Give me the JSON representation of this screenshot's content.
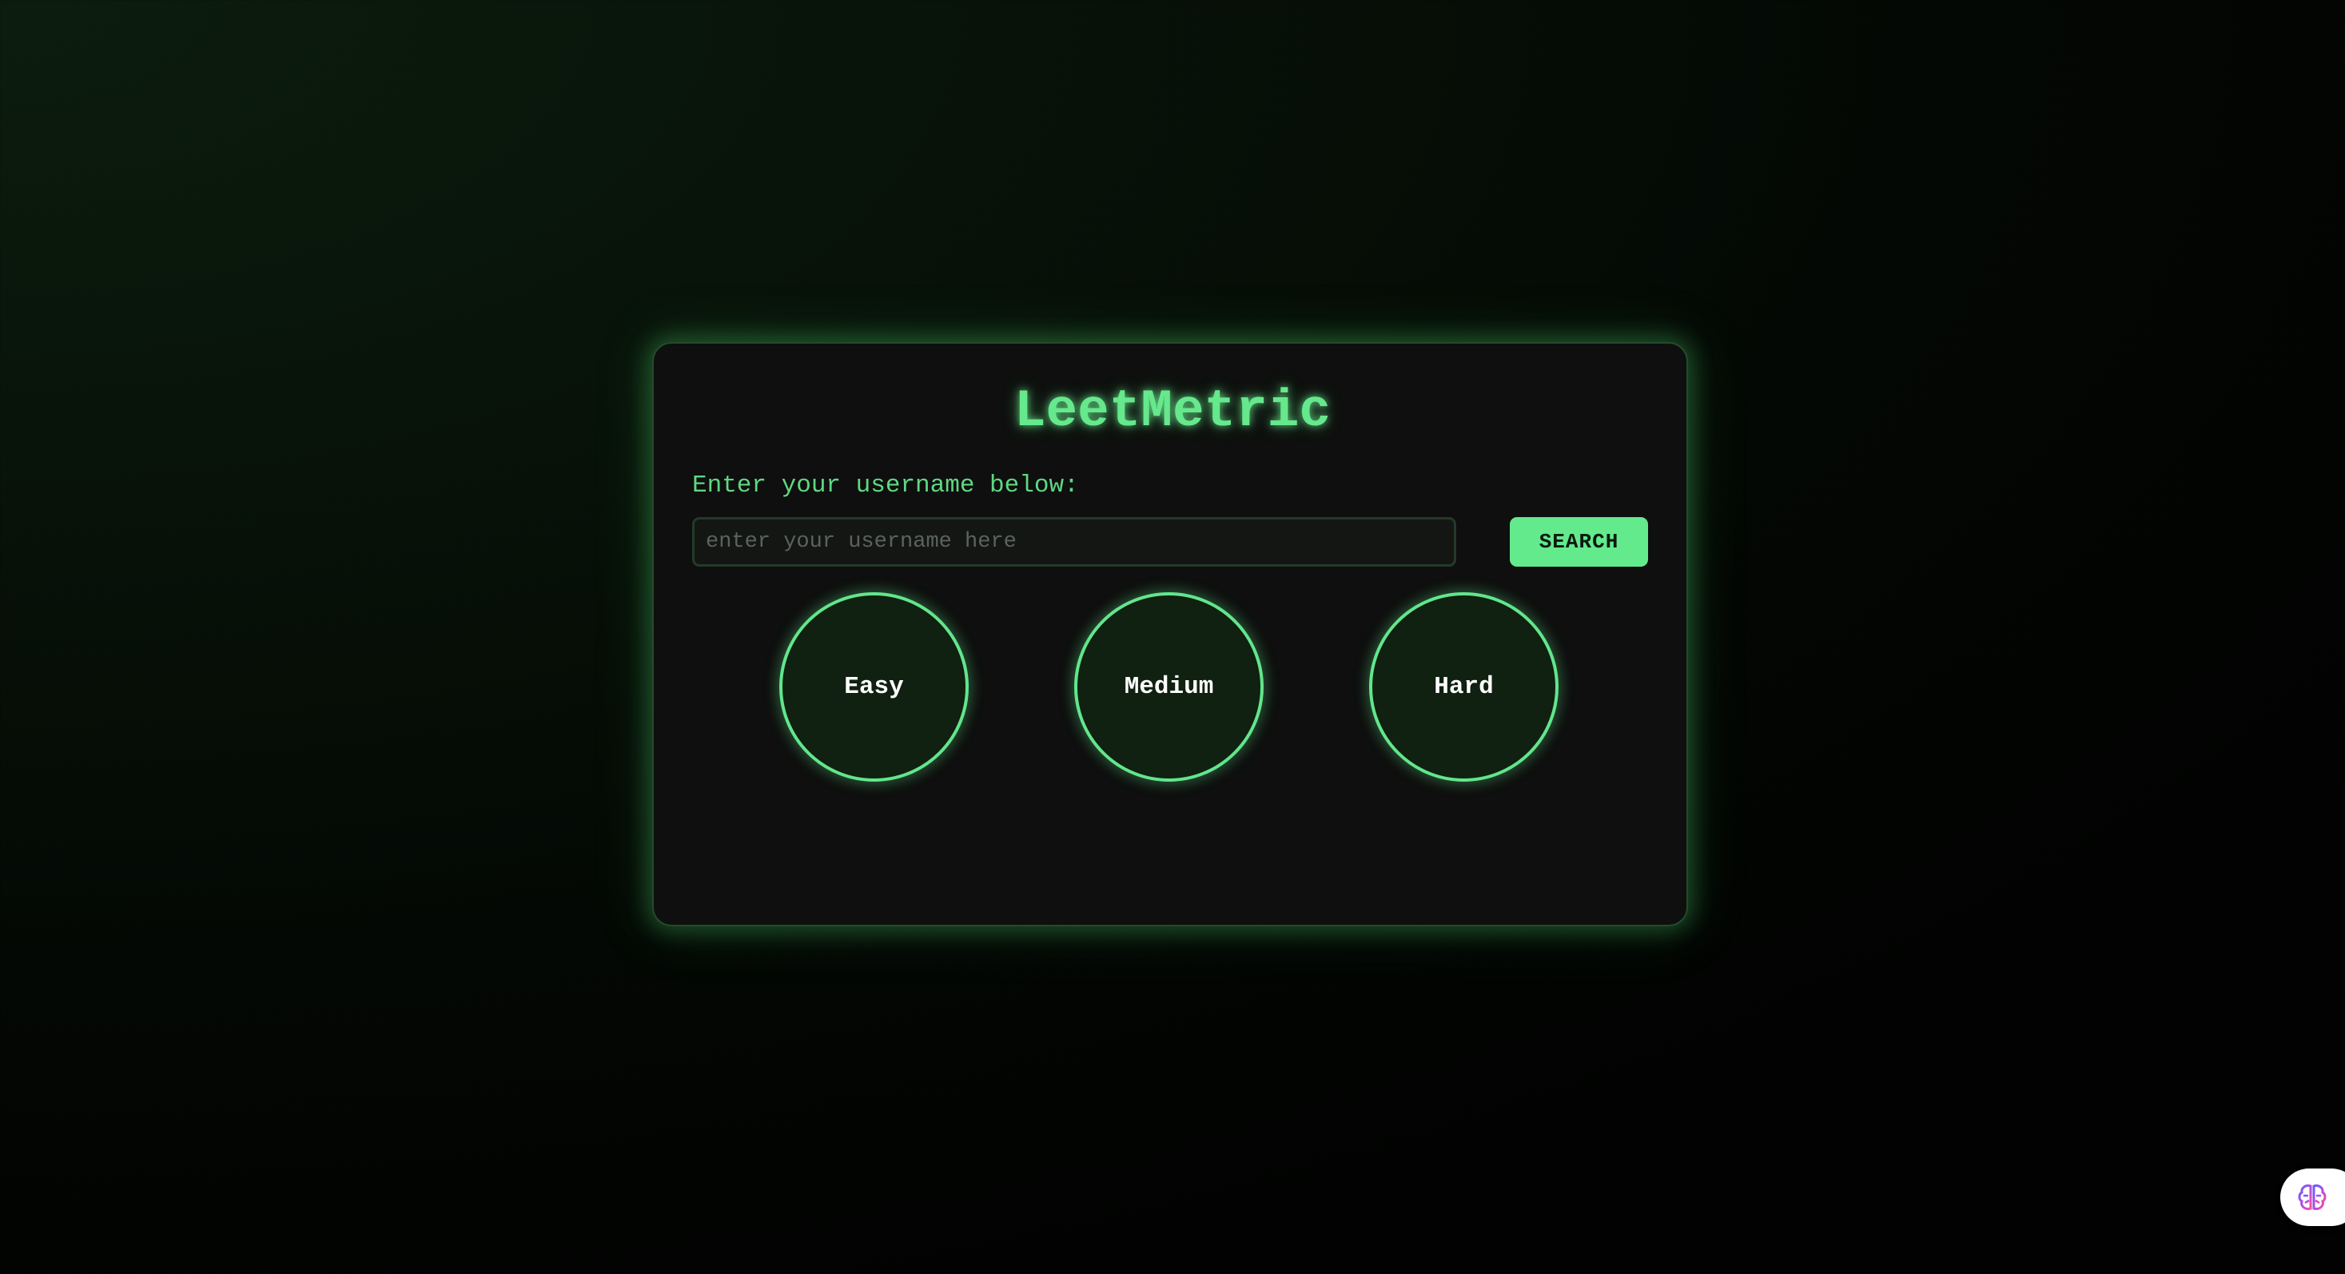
{
  "app": {
    "title": "LeetMetric"
  },
  "form": {
    "prompt_label": "Enter your username below:",
    "username_placeholder": "enter your username here",
    "username_value": "",
    "search_label": "SEARCH"
  },
  "difficulty": [
    {
      "label": "Easy"
    },
    {
      "label": "Medium"
    },
    {
      "label": "Hard"
    }
  ],
  "theme": {
    "accent": "#63ea8c",
    "card_background": "#0e0f0e",
    "page_background": "#030603",
    "circle_fill": "#102011"
  },
  "icons": {
    "extension_widget": "brain-icon"
  }
}
